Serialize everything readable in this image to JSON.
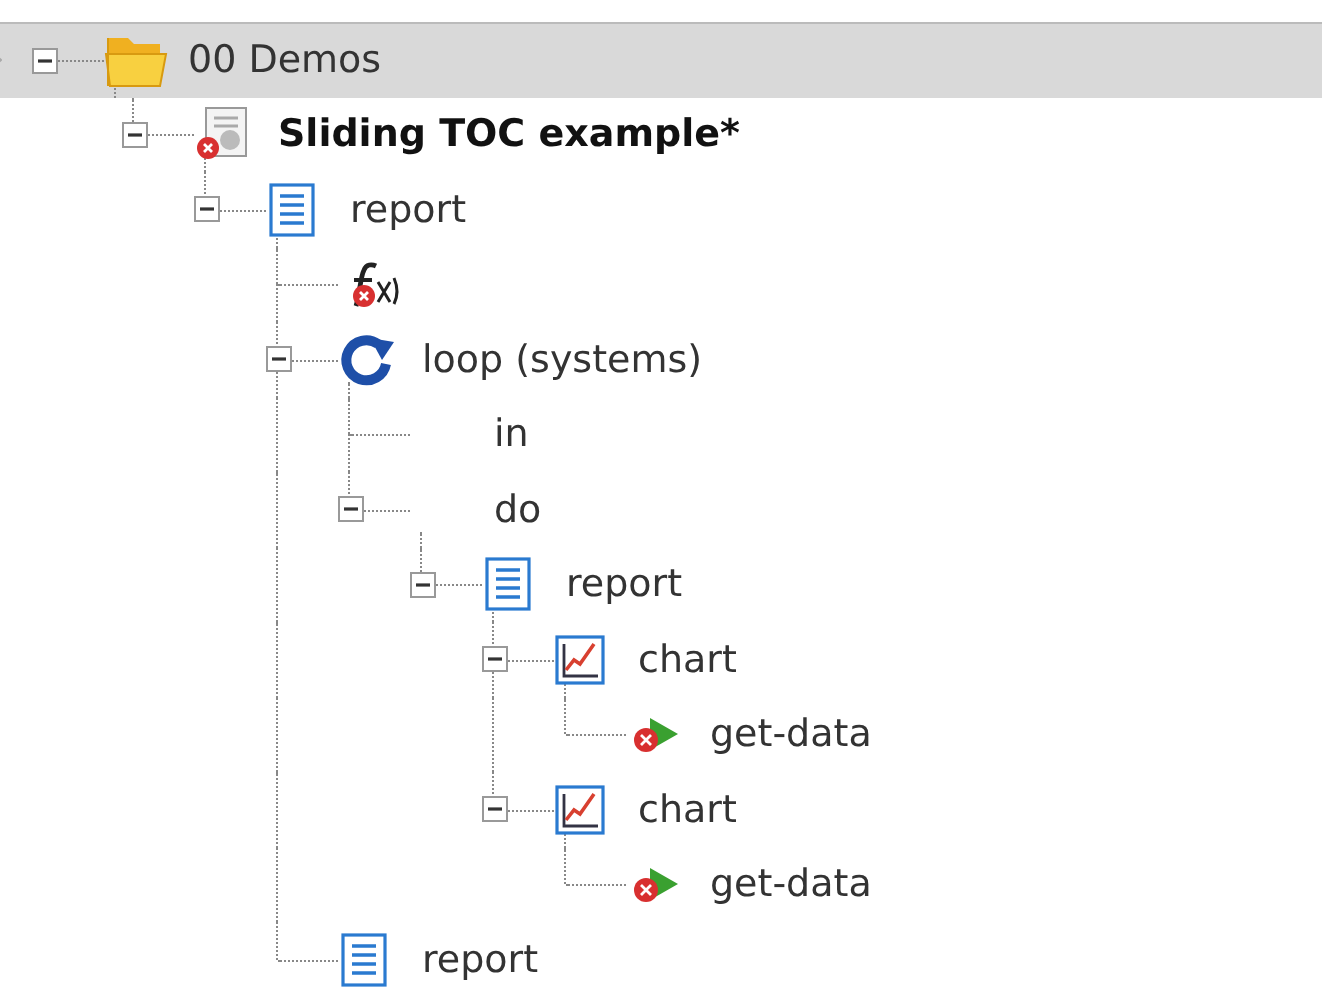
{
  "tree": [
    {
      "label": "00 Demos",
      "kind": "folder",
      "selected": true,
      "expanded": true,
      "children": [
        {
          "label": "Sliding TOC example*",
          "kind": "document-error",
          "selected": false,
          "bold": true,
          "expanded": true,
          "children": [
            {
              "label": "report",
              "kind": "report",
              "selected": false,
              "expanded": true,
              "children": [
                {
                  "kind": "function-error",
                  "selected": false
                },
                {
                  "label": "loop (systems)",
                  "kind": "loop",
                  "selected": false,
                  "expanded": true,
                  "children": [
                    {
                      "label": "in",
                      "selected": false
                    },
                    {
                      "label": "do",
                      "selected": false,
                      "expanded": true,
                      "children": [
                        {
                          "label": "report",
                          "kind": "report",
                          "selected": false,
                          "expanded": true,
                          "children": [
                            {
                              "label": "chart",
                              "kind": "chart",
                              "selected": false,
                              "expanded": true,
                              "children": [
                                {
                                  "label": "get-data",
                                  "kind": "action-error",
                                  "selected": false
                                }
                              ]
                            },
                            {
                              "label": "chart",
                              "kind": "chart",
                              "selected": false,
                              "expanded": true,
                              "children": [
                                {
                                  "label": "get-data",
                                  "kind": "action-error",
                                  "selected": false
                                }
                              ]
                            }
                          ]
                        }
                      ]
                    }
                  ]
                },
                {
                  "label": "report",
                  "kind": "report",
                  "selected": false
                }
              ]
            }
          ]
        }
      ]
    }
  ]
}
